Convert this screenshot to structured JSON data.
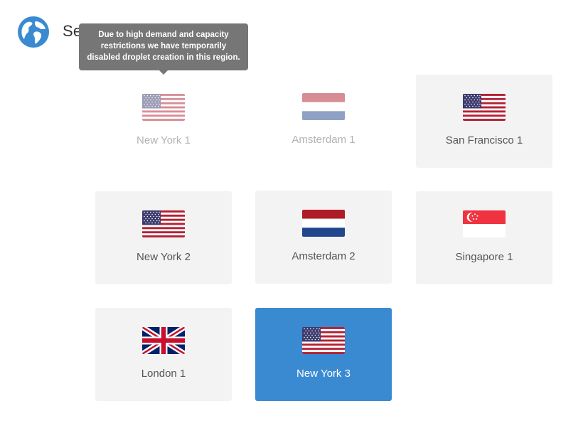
{
  "header": {
    "title": "Select Region",
    "icon": "globe-icon",
    "icon_color": "#3a8ad2"
  },
  "tooltip": {
    "text": "Due to high demand and capacity restrictions we have temporarily disabled droplet creation in this region."
  },
  "regions": [
    {
      "label": "New York 1",
      "flag": "us-flag-icon",
      "state": "disabled"
    },
    {
      "label": "Amsterdam 1",
      "flag": "nl-flag-icon",
      "state": "disabled"
    },
    {
      "label": "San Francisco 1",
      "flag": "us-flag-icon",
      "state": "available"
    },
    {
      "label": "New York 2",
      "flag": "us-flag-icon",
      "state": "available"
    },
    {
      "label": "Amsterdam 2",
      "flag": "nl-flag-icon",
      "state": "available"
    },
    {
      "label": "Singapore 1",
      "flag": "sg-flag-icon",
      "state": "available"
    },
    {
      "label": "London 1",
      "flag": "uk-flag-icon",
      "state": "available"
    },
    {
      "label": "New York 3",
      "flag": "us-flag-icon",
      "state": "selected"
    }
  ],
  "colors": {
    "selected": "#3a8ad2",
    "card": "#f3f3f3",
    "tooltip": "#767676"
  }
}
